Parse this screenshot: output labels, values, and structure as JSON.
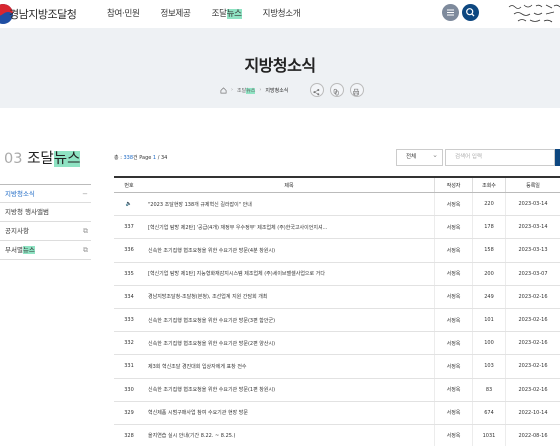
{
  "header": {
    "site_title": "경남지방조달청",
    "nav": [
      {
        "label": "참여·민원"
      },
      {
        "label": "정보제공"
      },
      {
        "label_pre": "조달",
        "label_hl": "뉴스"
      },
      {
        "label": "지방청소개"
      }
    ],
    "menu_icon": "hamburger-icon",
    "search_icon": "search-icon"
  },
  "banner": {
    "title": "지방청소식",
    "breadcrumb": {
      "home_icon": "home-icon",
      "level1_pre": "조달",
      "level1_hl": "뉴스",
      "current": "지방청소식"
    },
    "actions": [
      "share-icon",
      "link-icon",
      "print-icon"
    ]
  },
  "sidebar": {
    "number": "03",
    "title_pre": "조달",
    "title_hl": "뉴스",
    "items": [
      {
        "label": "지방청소식",
        "mark": "−"
      },
      {
        "label": "지방청 행사앨범",
        "mark": ""
      },
      {
        "label": "공지사항",
        "mark": "⧉"
      },
      {
        "label_pre": "부서별",
        "label_hl": "뉴스",
        "mark": "⧉"
      }
    ]
  },
  "board": {
    "total_label": "총 : ",
    "total_count": "338",
    "total_unit": "건",
    "page_label": "Page",
    "page_current": "1",
    "page_total": "34",
    "filter_value": "전체",
    "search_placeholder": "검색어 입력",
    "headers": {
      "no": "번호",
      "title": "제목",
      "writer": "작성자",
      "views": "조회수",
      "date": "등록일"
    },
    "rows": [
      {
        "no": "🔈",
        "title": "\"2023 조달현장 138개 규제혁신 길라잡이\" 안내",
        "writer": "서정옥",
        "views": "220",
        "date": "2023-03-14"
      },
      {
        "no": "337",
        "title": "[혁신기업 탐방 제2탄] '공급(4개) 재정부 우수정부' 제조업체 (주)한국고사이언지셔...",
        "writer": "서정옥",
        "views": "178",
        "date": "2023-03-14"
      },
      {
        "no": "336",
        "title": "신속한 조기집행 협조요청을 위한 수요기관 방문(4분 창원시)",
        "writer": "서정옥",
        "views": "158",
        "date": "2023-03-13"
      },
      {
        "no": "335",
        "title": "[혁신기업 탐방 제1탄] 지능형화재감지시스템 제조업체 (주)세이브밸셀사업으로 거다",
        "writer": "서정옥",
        "views": "200",
        "date": "2023-03-07"
      },
      {
        "no": "334",
        "title": "경남지방조달청-조달청(본청), 조선업계 지원 간담회 개최",
        "writer": "서정옥",
        "views": "249",
        "date": "2023-02-16"
      },
      {
        "no": "333",
        "title": "신속한 조기집행 협조요청을 위한 수요기관 방문(3편 함안군)",
        "writer": "서정옥",
        "views": "101",
        "date": "2023-02-16"
      },
      {
        "no": "332",
        "title": "신속한 조기집행 협조요청을 위한 수요기관 방문(2편 양산시)",
        "writer": "서정옥",
        "views": "100",
        "date": "2023-02-16"
      },
      {
        "no": "331",
        "title": "제3회 혁신조달 경진대회 입상자에게 표창 전수",
        "writer": "서정옥",
        "views": "103",
        "date": "2023-02-16"
      },
      {
        "no": "330",
        "title": "신속한 조기집행 협조요청을 위한 수요기관 방문(1편 창원시)",
        "writer": "서정옥",
        "views": "83",
        "date": "2023-02-16"
      },
      {
        "no": "329",
        "title": "혁신제품 시범구매사업 참여 수요기관 현장 방문",
        "writer": "서정옥",
        "views": "674",
        "date": "2022-10-14"
      },
      {
        "no": "328",
        "title": "을지연습 실시 안내(기간 8.22. ~ 8.25.)",
        "writer": "서정옥",
        "views": "1031",
        "date": "2022-08-16"
      }
    ]
  },
  "colors": {
    "accent_green": "#8fe3c3",
    "brand_navy": "#0d4780",
    "link_blue": "#1a67c4"
  }
}
